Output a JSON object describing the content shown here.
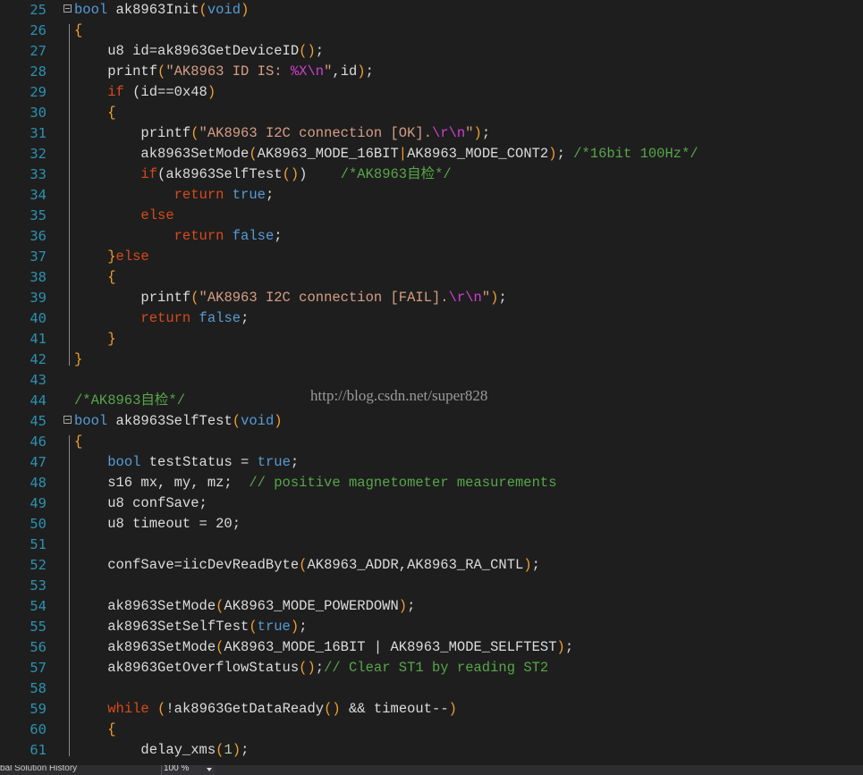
{
  "editor": {
    "watermark": "http://blog.csdn.net/super828",
    "line_numbers": [
      "25",
      "26",
      "27",
      "28",
      "29",
      "30",
      "31",
      "32",
      "33",
      "34",
      "35",
      "36",
      "37",
      "38",
      "39",
      "40",
      "41",
      "42",
      "43",
      "44",
      "45",
      "46",
      "47",
      "48",
      "49",
      "50",
      "51",
      "52",
      "53",
      "54",
      "55",
      "56",
      "57",
      "58",
      "59",
      "60",
      "61"
    ],
    "lines": [
      [
        {
          "t": "bool",
          "c": "kw"
        },
        {
          "t": " ak8963Init",
          "c": "plain"
        },
        {
          "t": "(",
          "c": "brk"
        },
        {
          "t": "void",
          "c": "kw"
        },
        {
          "t": ")",
          "c": "brk"
        }
      ],
      [
        {
          "t": "{",
          "c": "brk"
        }
      ],
      [
        {
          "t": "    u8 id=ak8963GetDeviceID",
          "c": "plain"
        },
        {
          "t": "()",
          "c": "brk"
        },
        {
          "t": ";",
          "c": "plain"
        }
      ],
      [
        {
          "t": "    printf",
          "c": "plain"
        },
        {
          "t": "(",
          "c": "brk"
        },
        {
          "t": "\"AK8963 ID IS: ",
          "c": "str"
        },
        {
          "t": "%X\\n",
          "c": "esc"
        },
        {
          "t": "\"",
          "c": "str"
        },
        {
          "t": ",id",
          "c": "plain"
        },
        {
          "t": ")",
          "c": "brk"
        },
        {
          "t": ";",
          "c": "plain"
        }
      ],
      [
        {
          "t": "    ",
          "c": "plain"
        },
        {
          "t": "if",
          "c": "ctlr"
        },
        {
          "t": " (id==0x48",
          "c": "plain"
        },
        {
          "t": ")",
          "c": "brk"
        }
      ],
      [
        {
          "t": "    {",
          "c": "brk"
        }
      ],
      [
        {
          "t": "        printf",
          "c": "plain"
        },
        {
          "t": "(",
          "c": "brk"
        },
        {
          "t": "\"AK8963 I2C connection [OK].",
          "c": "str"
        },
        {
          "t": "\\r\\n",
          "c": "esc"
        },
        {
          "t": "\"",
          "c": "str"
        },
        {
          "t": ")",
          "c": "brk"
        },
        {
          "t": ";",
          "c": "plain"
        }
      ],
      [
        {
          "t": "        ak8963SetMode",
          "c": "plain"
        },
        {
          "t": "(",
          "c": "brk"
        },
        {
          "t": "AK8963_MODE_16BIT",
          "c": "plain"
        },
        {
          "t": "|",
          "c": "brk"
        },
        {
          "t": "AK8963_MODE_CONT2",
          "c": "plain"
        },
        {
          "t": ")",
          "c": "brk"
        },
        {
          "t": "; ",
          "c": "plain"
        },
        {
          "t": "/*16bit 100Hz*/",
          "c": "cmt"
        }
      ],
      [
        {
          "t": "        ",
          "c": "plain"
        },
        {
          "t": "if",
          "c": "ctlr"
        },
        {
          "t": "(ak8963SelfTest",
          "c": "plain"
        },
        {
          "t": "()",
          "c": "brk"
        },
        {
          "t": ")    ",
          "c": "plain"
        },
        {
          "t": "/*AK8963自检*/",
          "c": "cmt"
        }
      ],
      [
        {
          "t": "            ",
          "c": "plain"
        },
        {
          "t": "return",
          "c": "ctlr"
        },
        {
          "t": " ",
          "c": "plain"
        },
        {
          "t": "true",
          "c": "kw"
        },
        {
          "t": ";",
          "c": "plain"
        }
      ],
      [
        {
          "t": "        ",
          "c": "plain"
        },
        {
          "t": "else",
          "c": "ctlr"
        }
      ],
      [
        {
          "t": "            ",
          "c": "plain"
        },
        {
          "t": "return",
          "c": "ctlr"
        },
        {
          "t": " ",
          "c": "plain"
        },
        {
          "t": "false",
          "c": "kw"
        },
        {
          "t": ";",
          "c": "plain"
        }
      ],
      [
        {
          "t": "    }",
          "c": "brk"
        },
        {
          "t": "else",
          "c": "ctlr"
        }
      ],
      [
        {
          "t": "    {",
          "c": "brk"
        }
      ],
      [
        {
          "t": "        printf",
          "c": "plain"
        },
        {
          "t": "(",
          "c": "brk"
        },
        {
          "t": "\"AK8963 I2C connection [FAIL].",
          "c": "str"
        },
        {
          "t": "\\r\\n",
          "c": "esc"
        },
        {
          "t": "\"",
          "c": "str"
        },
        {
          "t": ")",
          "c": "brk"
        },
        {
          "t": ";",
          "c": "plain"
        }
      ],
      [
        {
          "t": "        ",
          "c": "plain"
        },
        {
          "t": "return",
          "c": "ctlr"
        },
        {
          "t": " ",
          "c": "plain"
        },
        {
          "t": "false",
          "c": "kw"
        },
        {
          "t": ";",
          "c": "plain"
        }
      ],
      [
        {
          "t": "    }",
          "c": "brk"
        }
      ],
      [
        {
          "t": "}",
          "c": "brk"
        }
      ],
      [],
      [
        {
          "t": "/*AK8963自检*/",
          "c": "cmt"
        }
      ],
      [
        {
          "t": "bool",
          "c": "kw"
        },
        {
          "t": " ak8963SelfTest",
          "c": "plain"
        },
        {
          "t": "(",
          "c": "brk"
        },
        {
          "t": "void",
          "c": "kw"
        },
        {
          "t": ")",
          "c": "brk"
        }
      ],
      [
        {
          "t": "{",
          "c": "brk"
        }
      ],
      [
        {
          "t": "    ",
          "c": "plain"
        },
        {
          "t": "bool",
          "c": "kw"
        },
        {
          "t": " testStatus = ",
          "c": "plain"
        },
        {
          "t": "true",
          "c": "kw"
        },
        {
          "t": ";",
          "c": "plain"
        }
      ],
      [
        {
          "t": "    s16 mx, my, mz;  ",
          "c": "plain"
        },
        {
          "t": "// positive magnetometer measurements",
          "c": "cmt"
        }
      ],
      [
        {
          "t": "    u8 confSave;",
          "c": "plain"
        }
      ],
      [
        {
          "t": "    u8 timeout = 20;",
          "c": "plain"
        }
      ],
      [],
      [
        {
          "t": "    confSave=iicDevReadByte",
          "c": "plain"
        },
        {
          "t": "(",
          "c": "brk"
        },
        {
          "t": "AK8963_ADDR,AK8963_RA_CNTL",
          "c": "plain"
        },
        {
          "t": ")",
          "c": "brk"
        },
        {
          "t": ";",
          "c": "plain"
        }
      ],
      [],
      [
        {
          "t": "    ak8963SetMode",
          "c": "plain"
        },
        {
          "t": "(",
          "c": "brk"
        },
        {
          "t": "AK8963_MODE_POWERDOWN",
          "c": "plain"
        },
        {
          "t": ")",
          "c": "brk"
        },
        {
          "t": ";",
          "c": "plain"
        }
      ],
      [
        {
          "t": "    ak8963SetSelfTest",
          "c": "plain"
        },
        {
          "t": "(",
          "c": "brk"
        },
        {
          "t": "true",
          "c": "kw"
        },
        {
          "t": ")",
          "c": "brk"
        },
        {
          "t": ";",
          "c": "plain"
        }
      ],
      [
        {
          "t": "    ak8963SetMode",
          "c": "plain"
        },
        {
          "t": "(",
          "c": "brk"
        },
        {
          "t": "AK8963_MODE_16BIT | AK8963_MODE_SELFTEST",
          "c": "plain"
        },
        {
          "t": ")",
          "c": "brk"
        },
        {
          "t": ";",
          "c": "plain"
        }
      ],
      [
        {
          "t": "    ak8963GetOverflowStatus",
          "c": "plain"
        },
        {
          "t": "()",
          "c": "brk"
        },
        {
          "t": ";",
          "c": "plain"
        },
        {
          "t": "// Clear ST1 by reading ST2",
          "c": "cmt"
        }
      ],
      [],
      [
        {
          "t": "    ",
          "c": "plain"
        },
        {
          "t": "while",
          "c": "ctlr"
        },
        {
          "t": " ",
          "c": "plain"
        },
        {
          "t": "(",
          "c": "brk"
        },
        {
          "t": "!ak8963GetDataReady",
          "c": "plain"
        },
        {
          "t": "()",
          "c": "brk"
        },
        {
          "t": " && timeout--",
          "c": "plain"
        },
        {
          "t": ")",
          "c": "brk"
        }
      ],
      [
        {
          "t": "    {",
          "c": "brk"
        }
      ],
      [
        {
          "t": "        delay_xms",
          "c": "plain"
        },
        {
          "t": "(",
          "c": "brk"
        },
        {
          "t": "1",
          "c": "num"
        },
        {
          "t": ")",
          "c": "brk"
        },
        {
          "t": ";",
          "c": "plain"
        }
      ]
    ],
    "fold_lines": [
      0,
      20
    ]
  },
  "statusbar": {
    "tab_text": "bal Solution History",
    "zoom": "100 %"
  },
  "colors": {
    "background": "#1e1e1e",
    "line_number": "#2b91af",
    "keyword": "#569cd6",
    "comment": "#57a64a",
    "string": "#d69d85"
  }
}
